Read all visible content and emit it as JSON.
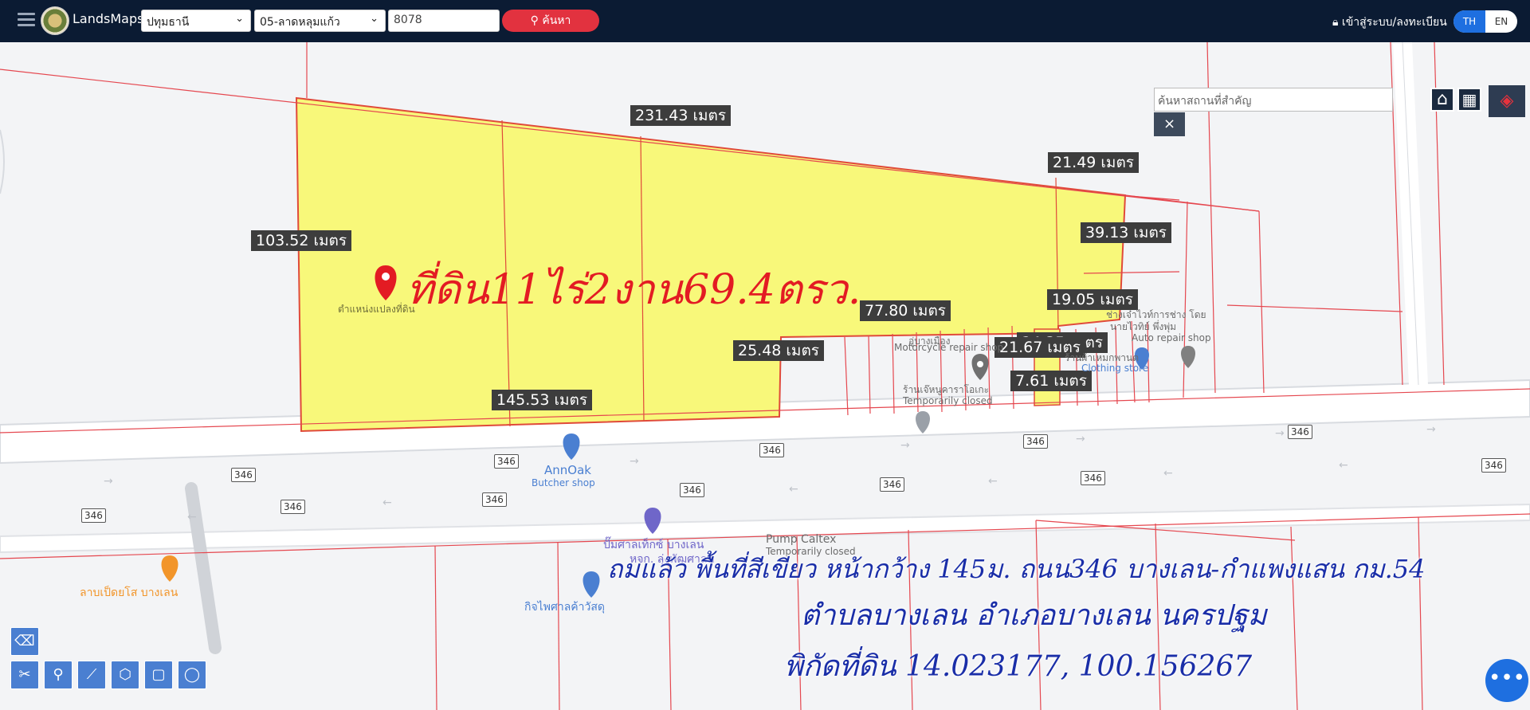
{
  "header": {
    "brand": "LandsMaps",
    "province": "ปทุมธานี",
    "district": "05-ลาดหลุมแก้ว",
    "parcel_no": "8078",
    "search_label": "ค้นหา",
    "login_label": "เข้าสู่ระบบ/ลงทะเบียน",
    "lang_th": "TH",
    "lang_en": "EN"
  },
  "map_controls": {
    "place_search_placeholder": "ค้นหาสถานที่สำคัญ",
    "close_label": "×",
    "home_label": "⌂",
    "grid_label": "▦",
    "layers_label": "◈"
  },
  "dimensions": {
    "top": "231.43 เมตร",
    "top_right": "21.49 เมตร",
    "left": "103.52 เมตร",
    "right": "39.13 เมตร",
    "notch_right": "19.05 เมตร",
    "notch_top": "77.80 เมตร",
    "notch_left": "25.48 เมตร",
    "bottom": "145.53 เมตร",
    "small1": "24.35 เมตร",
    "small2": "21.67 เมตร",
    "small3": "7.61 เมตร"
  },
  "overlay": {
    "headline": "ที่ดิน11ไร่2งาน69.4ตรว.",
    "line1": "ถมแล้ว พื้นที่สีเขียว หน้ากว้าง 145ม. ถนน346 บางเลน-กำแพงแสน กม.54",
    "line2": "ตำบลบางเลน อำเภอบางเลน นครปฐม",
    "line3": "พิกัดที่ดิน 14.023177, 100.156267"
  },
  "pois": {
    "parcel_label": "ตำแหน่งแปลงที่ดิน",
    "moto1": "อู่บางเมือง",
    "moto2": "Motorcycle repair shop",
    "shop_th": "ร้านเจ๊หนูคาราโอเกะ",
    "shop_en": "Temporarily closed",
    "auto_th1": "ช่างเจ๋าไวท์การช่าง โดย",
    "auto_th2": "นายไวทิย์ พึ่งพุ่ม",
    "auto_en": "Auto repair shop",
    "clothing_th": "ร้านผ้าเหมกพานต",
    "clothing_en": "Clothing store",
    "annoak": "AnnOak",
    "butcher": "Butcher shop",
    "pump1": "ปั๊มศาลเท็กซ์ บางเลน",
    "pump2": "หจก. ลุ่งพัฒศาลพ",
    "caltex": "Pump Caltex",
    "caltex_status": "Temporarily closed",
    "restaurant": "ลาบเป็ดยโส บางเลน",
    "kitchen": "กิจไพศาลค้าวัสดุ"
  },
  "routes": [
    "346",
    "346",
    "346",
    "346",
    "346",
    "346",
    "346",
    "346",
    "346",
    "346",
    "346",
    "346"
  ]
}
